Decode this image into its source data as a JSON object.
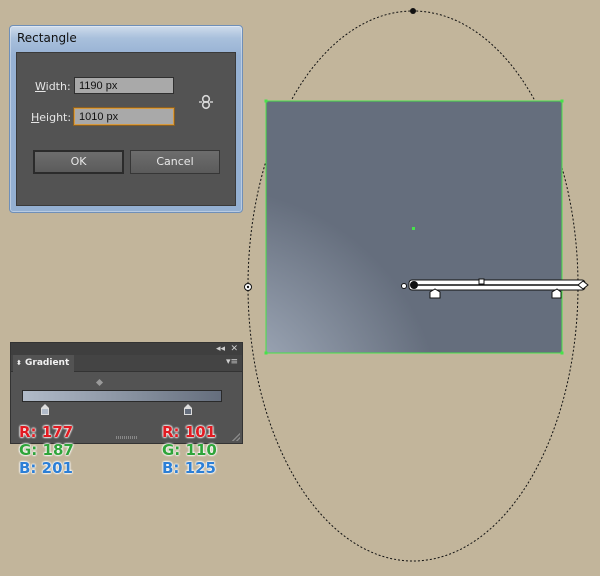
{
  "dialog": {
    "title": "Rectangle",
    "width_label_u": "W",
    "width_label_rest": "idth:",
    "width_value": "1190 px",
    "height_label_u": "H",
    "height_label_rest": "eight:",
    "height_value": "1010 px",
    "ok_label": "OK",
    "cancel_label": "Cancel",
    "constrain_icon": "link-icon"
  },
  "gradient_panel": {
    "title": "Gradient",
    "collapse_glyph": "◂◂",
    "close_glyph": "✕",
    "menu_glyph": "▾≡",
    "tab_arrow": "◆",
    "stops": [
      {
        "color": "#b1bbc9",
        "position": 0
      },
      {
        "color": "#656e7d",
        "position": 100
      }
    ],
    "midpoint": 50
  },
  "readouts": {
    "left": {
      "r_label": "R:",
      "r": "177",
      "g_label": "G:",
      "g": "187",
      "b_label": "B:",
      "b": "201"
    },
    "right": {
      "r_label": "R:",
      "r": "101",
      "g_label": "G:",
      "g": "110",
      "b_label": "B:",
      "b": "125"
    }
  },
  "colors": {
    "canvas_bg": "#c2b59b",
    "gradient_center": "#b1bbc9",
    "gradient_edge": "#656e7d",
    "selection": "#46e34a"
  }
}
